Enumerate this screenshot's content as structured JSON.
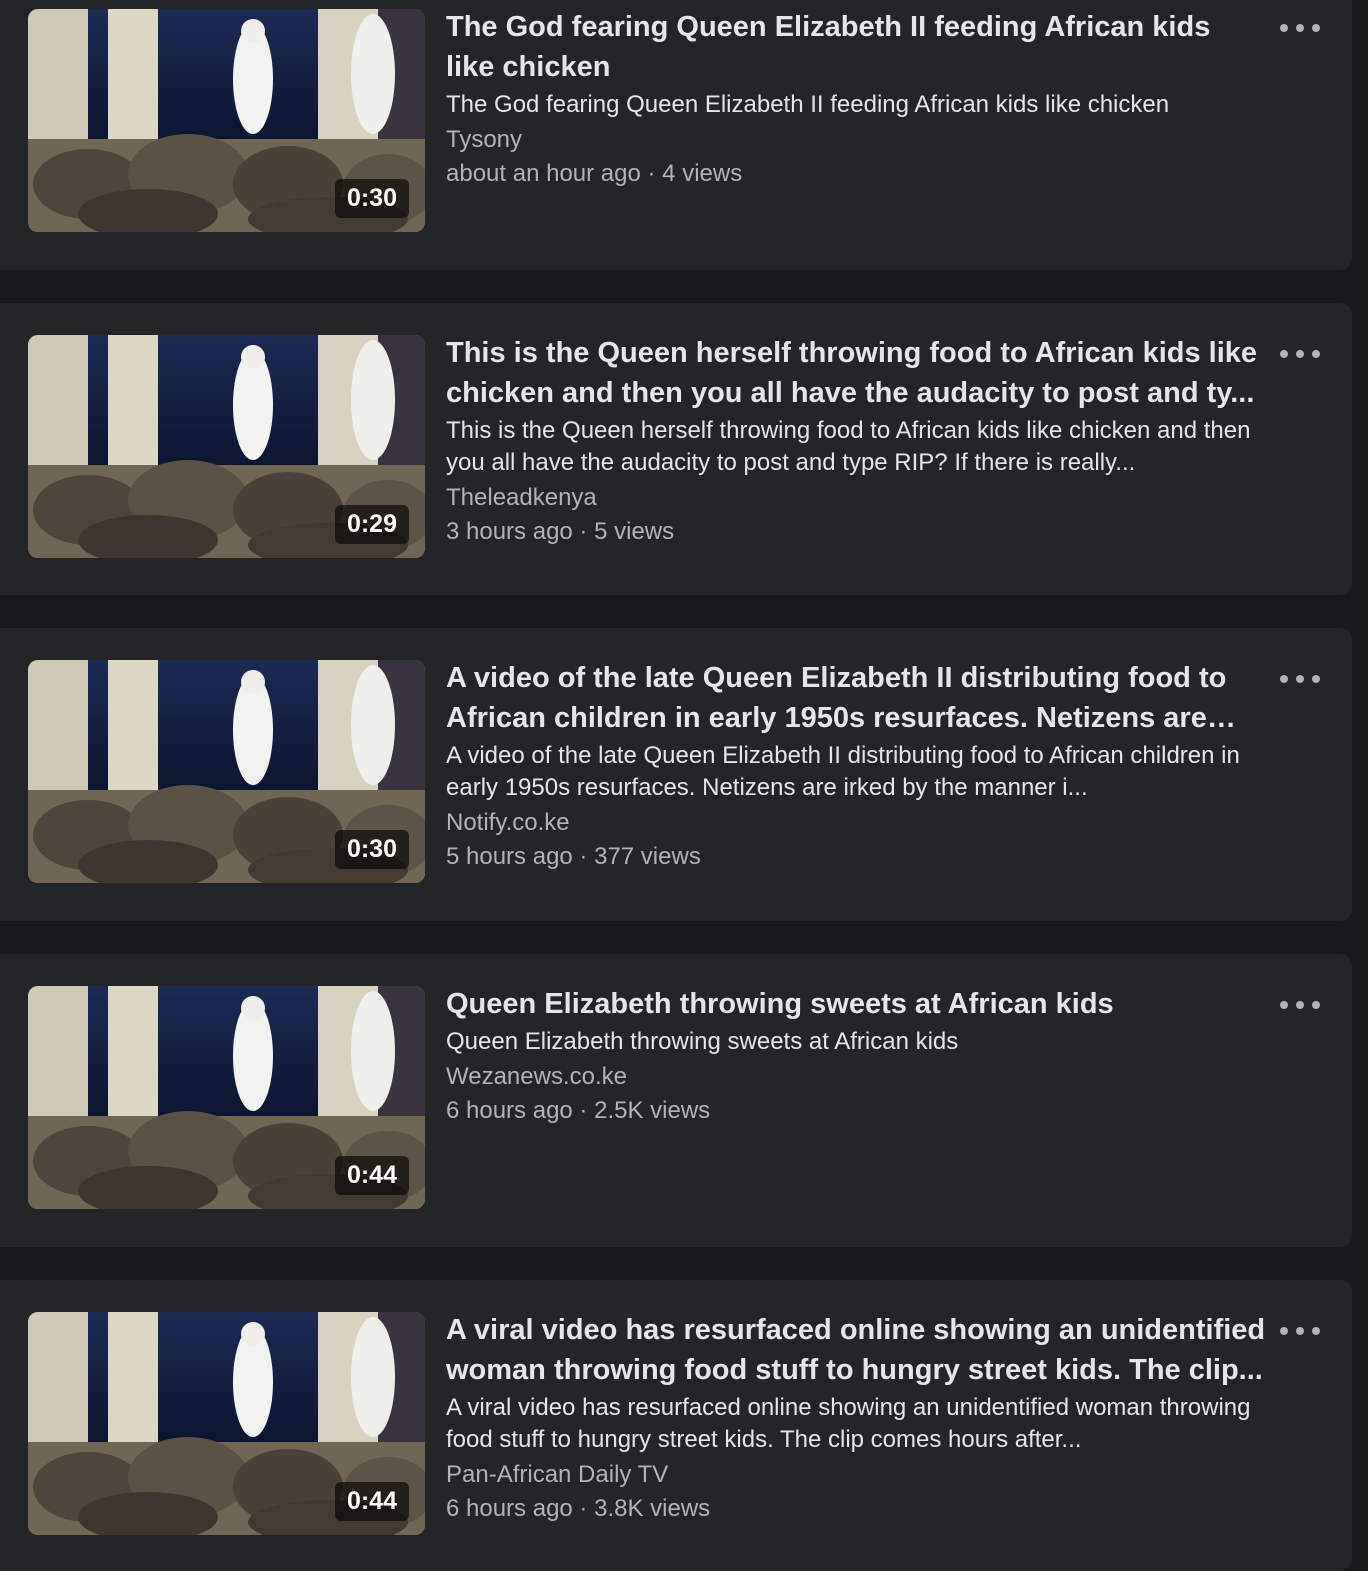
{
  "videos": [
    {
      "title": "The God fearing Queen Elizabeth II feeding African kids like chicken",
      "description": "The God fearing Queen Elizabeth II feeding African kids like chicken",
      "channel": "Tysony",
      "time": "about an hour ago",
      "views": "4 views",
      "duration": "0:30"
    },
    {
      "title": "This is the Queen herself throwing food to African kids like chicken and then you all have the audacity to post and ty...",
      "description": "This is the Queen herself throwing food to African kids like chicken and then you all have the audacity to post and type RIP? If there is really...",
      "channel": "Theleadkenya",
      "time": "3 hours ago",
      "views": "5 views",
      "duration": "0:29"
    },
    {
      "title": "A video of the late Queen Elizabeth II distributing food to African children in early 1950s resurfaces. Netizens are irk...",
      "description": "A video of the late Queen Elizabeth II distributing food to African children in early 1950s resurfaces. Netizens are irked by the manner i...",
      "channel": "Notify.co.ke",
      "time": "5 hours ago",
      "views": "377 views",
      "duration": "0:30"
    },
    {
      "title": "Queen Elizabeth throwing sweets at African kids",
      "description": "Queen Elizabeth throwing sweets at African kids",
      "channel": "Wezanews.co.ke",
      "time": "6 hours ago",
      "views": "2.5K views",
      "duration": "0:44"
    },
    {
      "title": "A viral video has resurfaced online showing an unidentified woman throwing food stuff to hungry street kids. The clip...",
      "description": "A viral video has resurfaced online showing an unidentified woman throwing food stuff to hungry street kids. The clip comes hours after...",
      "channel": "Pan-African Daily TV",
      "time": "6 hours ago",
      "views": "3.8K views",
      "duration": "0:44"
    }
  ],
  "meta_separator": " · ",
  "colors": {
    "page_bg": "#18191a",
    "card_bg": "#242526",
    "primary_text": "#e4e6eb",
    "secondary_text": "#b0b3b8"
  },
  "icons": {
    "more": "more-options-icon"
  }
}
